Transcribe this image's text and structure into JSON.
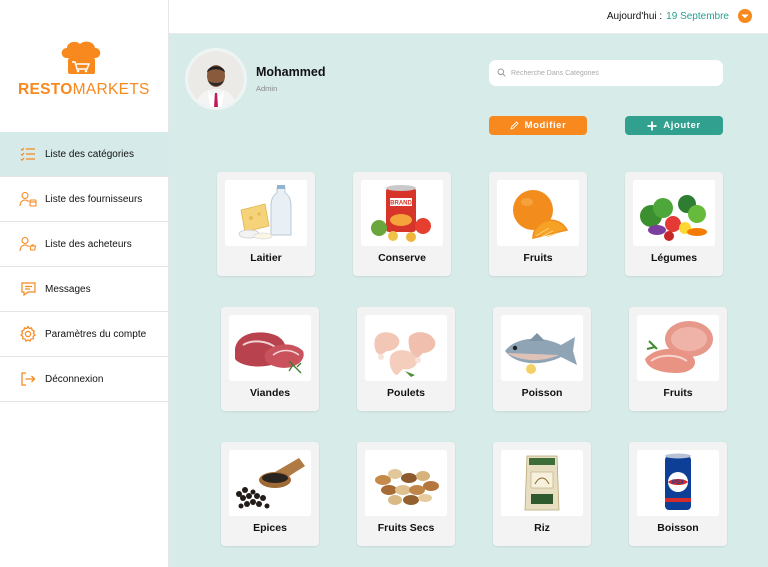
{
  "brand": {
    "part1": "RESTO",
    "part2": "MARKETS",
    "color": "#f7891e"
  },
  "sidebar": {
    "items": [
      {
        "label": "Liste des catégories",
        "icon": "list-icon",
        "active": true
      },
      {
        "label": "Liste des fournisseurs",
        "icon": "suppliers-icon",
        "active": false
      },
      {
        "label": "Liste des acheteurs",
        "icon": "buyers-icon",
        "active": false
      },
      {
        "label": "Messages",
        "icon": "message-icon",
        "active": false
      },
      {
        "label": "Paramètres du compte",
        "icon": "gear-icon",
        "active": false
      },
      {
        "label": "Déconnexion",
        "icon": "logout-icon",
        "active": false
      }
    ]
  },
  "topbar": {
    "date_label": "Aujourd'hui :",
    "date_value": "19 Septembre"
  },
  "profile": {
    "name": "Mohammed",
    "role": "Admin"
  },
  "search": {
    "placeholder": "Recherche Dans Catégories"
  },
  "actions": {
    "edit_label": "Modifier",
    "add_label": "Ajouter"
  },
  "categories": [
    {
      "label": "Laitier",
      "icon": "dairy-icon"
    },
    {
      "label": "Conserve",
      "icon": "canned-food-icon"
    },
    {
      "label": "Fruits",
      "icon": "orange-icon"
    },
    {
      "label": "Légumes",
      "icon": "vegetables-icon"
    },
    {
      "label": "Viandes",
      "icon": "meat-icon"
    },
    {
      "label": "Poulets",
      "icon": "chicken-icon"
    },
    {
      "label": "Poisson",
      "icon": "fish-icon"
    },
    {
      "label": "Fruits",
      "icon": "ham-icon"
    },
    {
      "label": "Epices",
      "icon": "spices-icon"
    },
    {
      "label": "Fruits Secs",
      "icon": "nuts-icon"
    },
    {
      "label": "Riz",
      "icon": "rice-bag-icon"
    },
    {
      "label": "Boisson",
      "icon": "soda-can-icon"
    }
  ],
  "colors": {
    "accent_orange": "#f7891e",
    "accent_teal": "#31a08e",
    "main_bg": "#d7ebe9",
    "date_teal": "#2a9d8f"
  }
}
